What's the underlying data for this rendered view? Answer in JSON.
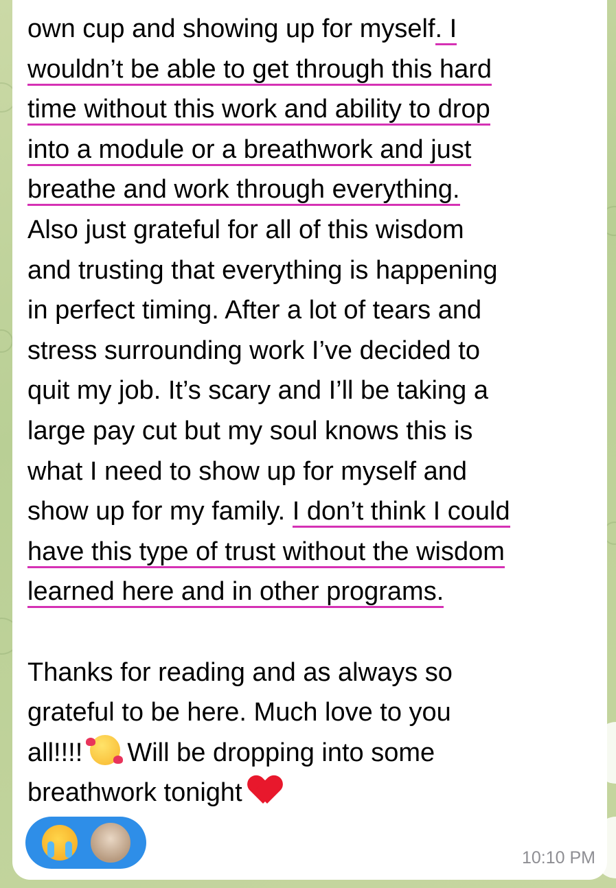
{
  "message": {
    "lines": [
      {
        "pre": "own cup and showing up for myself",
        "hl": ". I",
        "post": ""
      },
      {
        "pre": "",
        "hl": "wouldn’t be able to get through this hard",
        "post": ""
      },
      {
        "pre": "",
        "hl": "time without this work and ability to drop",
        "post": ""
      },
      {
        "pre": "",
        "hl": "into a module or a breathwork and just",
        "post": ""
      },
      {
        "pre": "",
        "hl": "breathe and work through everything.",
        "post": ""
      },
      {
        "pre": "Also just grateful for all of this wisdom",
        "hl": "",
        "post": ""
      },
      {
        "pre": "and trusting that everything is happening",
        "hl": "",
        "post": ""
      },
      {
        "pre": "in perfect timing. After a lot of tears and",
        "hl": "",
        "post": ""
      },
      {
        "pre": "stress surrounding work I’ve decided to",
        "hl": "",
        "post": ""
      },
      {
        "pre": "quit my job. It’s scary and I’ll be taking a",
        "hl": "",
        "post": ""
      },
      {
        "pre": "large pay cut but my soul knows this is",
        "hl": "",
        "post": ""
      },
      {
        "pre": "what I need to show up for myself and",
        "hl": "",
        "post": ""
      },
      {
        "pre": "show up for my family. ",
        "hl": "I don’t think I could",
        "post": ""
      },
      {
        "pre": "",
        "hl": "have this type of trust without the wisdom",
        "post": ""
      },
      {
        "pre": "",
        "hl": "learned here and in other programs.",
        "post": ""
      }
    ],
    "closing_1": "Thanks for reading and as always so",
    "closing_2": "grateful to be here. Much love to you",
    "closing_3a": "all!!!! ",
    "closing_3b": " Will be dropping into some",
    "closing_4": "breathwork tonight ",
    "emoji_1": "smiling-face-with-hearts-icon",
    "emoji_2": "red-heart-icon"
  },
  "reactions": {
    "emoji": "loudly-crying-face-icon",
    "reactor": "avatar"
  },
  "timestamp": "10:10 PM",
  "colors": {
    "highlight_underline": "#d531b4",
    "reaction_pill": "#2e8ee8",
    "timestamp": "#8e8e93"
  }
}
